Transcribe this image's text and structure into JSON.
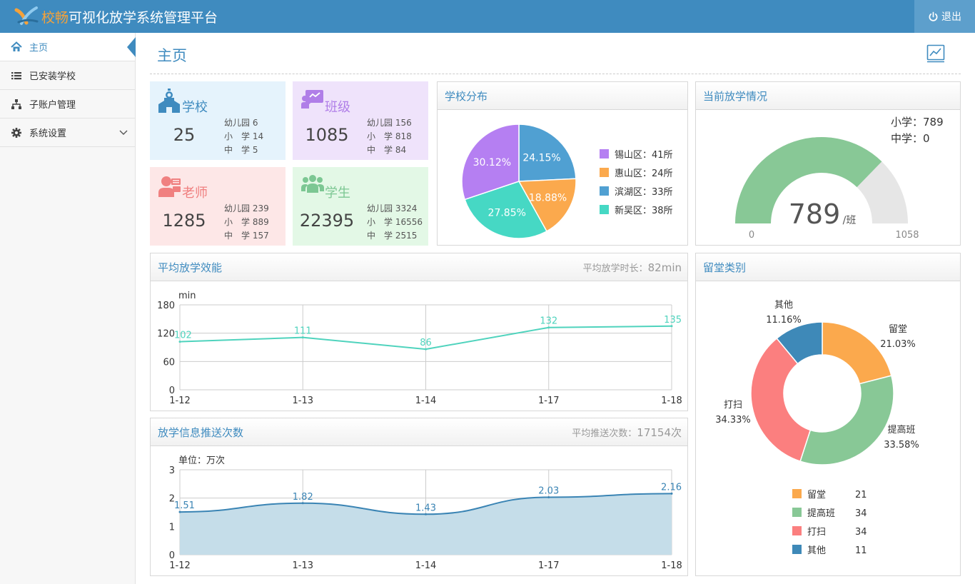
{
  "app": {
    "title_highlight": "校畅",
    "title_rest": "可视化放学系统管理平台",
    "logout_label": "退出"
  },
  "sidebar": {
    "items": [
      {
        "label": "主页",
        "icon": "home-icon",
        "active": true
      },
      {
        "label": "已安装学校",
        "icon": "list-icon"
      },
      {
        "label": "子账户管理",
        "icon": "sitemap-icon"
      },
      {
        "label": "系统设置",
        "icon": "gear-icon",
        "has_submenu": true
      }
    ]
  },
  "page": {
    "title": "主页"
  },
  "stats": [
    {
      "label": "学校",
      "total": "25",
      "icon": "school-icon",
      "color": "#3f8bbf",
      "bg": "#e5f3fc",
      "sub": [
        "幼儿园 6",
        "小　学 14",
        "中　学 5"
      ]
    },
    {
      "label": "班级",
      "total": "1085",
      "icon": "blackboard-icon",
      "color": "#b07ee8",
      "bg": "#efe3fb",
      "sub": [
        "幼儿园 156",
        "小　学 818",
        "中　学 84"
      ]
    },
    {
      "label": "老师",
      "total": "1285",
      "icon": "teacher-icon",
      "color": "#f08080",
      "bg": "#fde7e7",
      "sub": [
        "幼儿园 239",
        "小　学 889",
        "中　学 157"
      ]
    },
    {
      "label": "学生",
      "total": "22395",
      "icon": "students-icon",
      "color": "#7cc793",
      "bg": "#e3f8e6",
      "sub": [
        "幼儿园 3324",
        "小　学 16556",
        "中　学 2515"
      ]
    }
  ],
  "panels": {
    "school_dist": {
      "title": "学校分布"
    },
    "current": {
      "title": "当前放学情况",
      "primary_line": "小学：789",
      "middle_line": "中学：0"
    },
    "efficiency": {
      "title": "平均放学效能",
      "meta_label": "平均放学时长：",
      "meta_value": "82min"
    },
    "push": {
      "title": "放学信息推送次数",
      "meta_label": "平均推送次数：",
      "meta_value": "17154次"
    },
    "stay": {
      "title": "留堂类别"
    }
  },
  "chart_data": [
    {
      "type": "pie",
      "name": "school-distribution",
      "slices": [
        {
          "label": "锡山区：41所",
          "value": 41,
          "percent_label": "30.12%",
          "color": "#b57ff2"
        },
        {
          "label": "惠山区：24所",
          "value": 24,
          "percent_label": "18.88%",
          "color": "#fba94d"
        },
        {
          "label": "滨湖区：33所",
          "value": 33,
          "percent_label": "24.15%",
          "color": "#50a0d2"
        },
        {
          "label": "新吴区：38所",
          "value": 38,
          "percent_label": "27.85%",
          "color": "#46d8c4"
        }
      ],
      "display_order": [
        2,
        1,
        3,
        0
      ],
      "legend_order": [
        0,
        1,
        2,
        3
      ],
      "legend_position": "right"
    },
    {
      "type": "gauge",
      "name": "current-dismissal",
      "value": 789,
      "min": 0,
      "max": 1058,
      "value_label": "789",
      "unit": "/班",
      "min_label": "0",
      "max_label": "1058",
      "fill_color": "#88c896",
      "track_color": "#e6e6e6"
    },
    {
      "type": "line",
      "name": "average-dismissal-efficiency",
      "x": [
        "1-12",
        "1-13",
        "1-14",
        "1-17",
        "1-18"
      ],
      "values": [
        102,
        111,
        86,
        132,
        135
      ],
      "data_labels": [
        "102",
        "111",
        "86",
        "132",
        "135"
      ],
      "ylabel": "min",
      "ylim": [
        0,
        180
      ],
      "yticks": [
        "0",
        "60",
        "120",
        "180"
      ],
      "grid": true,
      "color": "#4fd3bd"
    },
    {
      "type": "area",
      "name": "push-notification-count",
      "x": [
        "1-12",
        "1-13",
        "1-14",
        "1-17",
        "1-18"
      ],
      "values": [
        1.51,
        1.82,
        1.43,
        2.03,
        2.16
      ],
      "data_labels": [
        "1.51",
        "1.82",
        "1.43",
        "2.03",
        "2.16"
      ],
      "ylabel": "单位：万次",
      "ylim": [
        0,
        3
      ],
      "yticks": [
        "0",
        "1",
        "2",
        "3"
      ],
      "grid": true,
      "color": "#3a84b4",
      "fill": "#c5dde9"
    },
    {
      "type": "pie",
      "name": "after-school-category",
      "donut": true,
      "slices": [
        {
          "label": "留堂",
          "value": 21,
          "percent_label": "21.03%",
          "color": "#fba94d"
        },
        {
          "label": "提高班",
          "value": 34,
          "percent_label": "33.58%",
          "color": "#88c896"
        },
        {
          "label": "打扫",
          "value": 34,
          "percent_label": "34.33%",
          "color": "#fb7f7f"
        },
        {
          "label": "其他",
          "value": 11,
          "percent_label": "11.16%",
          "color": "#3e89b8"
        }
      ],
      "legend_position": "bottom"
    }
  ]
}
